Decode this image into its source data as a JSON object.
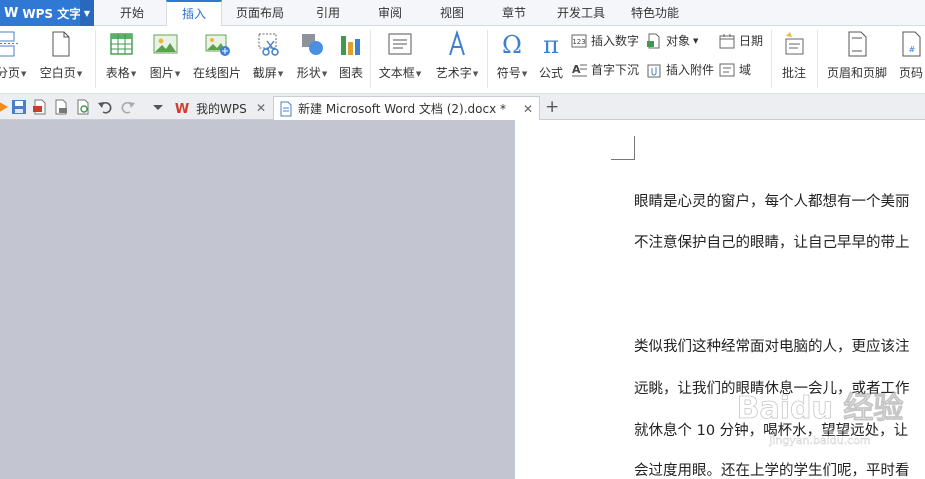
{
  "app": {
    "name": "WPS 文字",
    "logo_letter": "W"
  },
  "menu": {
    "tabs": [
      "开始",
      "插入",
      "页面布局",
      "引用",
      "审阅",
      "视图",
      "章节",
      "开发工具",
      "特色功能"
    ],
    "active": "插入"
  },
  "ribbon": {
    "page_break": "分页",
    "blank_page": "空白页",
    "table": "表格",
    "picture": "图片",
    "online_picture": "在线图片",
    "screenshot": "截屏",
    "shapes": "形状",
    "chart": "图表",
    "textbox": "文本框",
    "wordart": "艺术字",
    "symbol": "符号",
    "formula": "公式",
    "insert_number": "插入数字",
    "object": "对象",
    "date": "日期",
    "drop_cap": "首字下沉",
    "insert_attachment": "插入附件",
    "field": "域",
    "comment": "批注",
    "header_footer": "页眉和页脚",
    "page_number": "页码"
  },
  "doc_tabs": [
    {
      "label": "我的WPS",
      "active": false
    },
    {
      "label": "新建 Microsoft Word 文档 (2).docx *",
      "active": true
    }
  ],
  "document": {
    "lines": [
      "眼睛是心灵的窗户，每个人都想有一个美丽",
      "不注意保护自己的眼睛，让自己早早的带上",
      "类似我们这种经常面对电脑的人，更应该注",
      "远眺，让我们的眼睛休息一会儿，或者工作",
      "就休息个 10 分钟，喝杯水，望望远处，让",
      "会过度用眼。还在上学的学生们呢，平时看"
    ]
  },
  "watermark": {
    "brand": "Baidu 经验",
    "url": "jingyan.baidu.com"
  },
  "colors": {
    "accent": "#2f78d4",
    "workspace": "#c3c6d1"
  }
}
